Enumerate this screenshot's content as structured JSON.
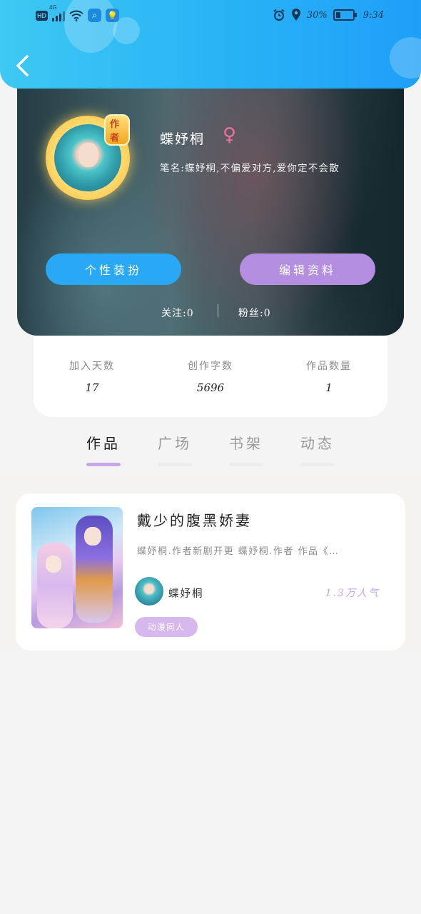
{
  "status_bar": {
    "left_badge": "HD",
    "network": "4G",
    "battery_percent": "30%",
    "time": "9:34"
  },
  "header": {
    "back_icon": "chevron-left-icon"
  },
  "profile": {
    "author_badge": "作者",
    "name": "蝶妤桐",
    "gender_symbol": "♀",
    "pen_name": "笔名:蝶妤桐,不偏爱对方,爱你定不会散",
    "buttons": {
      "style": "个性装扮",
      "edit": "编辑资料"
    },
    "following": "关注:0",
    "fans": "粉丝:0"
  },
  "stats": [
    {
      "label": "加入天数",
      "value": "17"
    },
    {
      "label": "创作字数",
      "value": "5696"
    },
    {
      "label": "作品数量",
      "value": "1"
    }
  ],
  "tabs": [
    {
      "label": "作品",
      "active": true
    },
    {
      "label": "广场",
      "active": false
    },
    {
      "label": "书架",
      "active": false
    },
    {
      "label": "动态",
      "active": false
    }
  ],
  "works": [
    {
      "title": "戴少的腹黑娇妻",
      "description": "蝶妤桐.作者新剧开更 蝶妤桐.作者 作品《…",
      "author": "蝶妤桐",
      "popularity": "1.3万人气",
      "tag": "动漫同人"
    }
  ],
  "colors": {
    "header_blue": "#28b2f6",
    "style_button": "#29a8f5",
    "edit_button": "#b48ee0",
    "accent_purple": "#c8a8ea"
  }
}
